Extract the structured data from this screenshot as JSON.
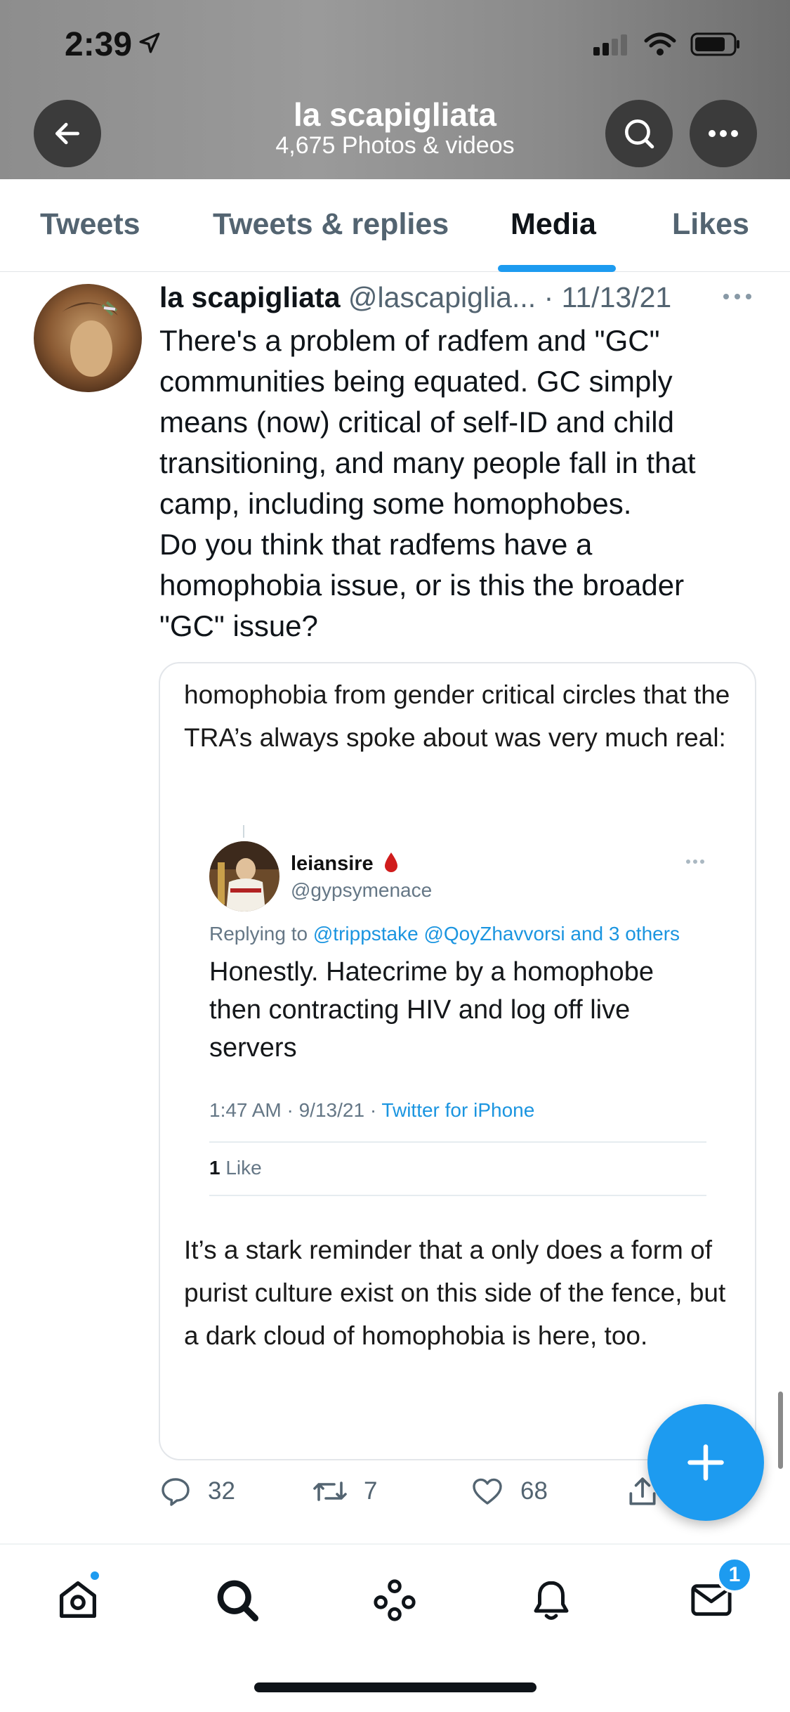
{
  "status_bar": {
    "time": "2:39"
  },
  "header": {
    "title": "la scapigliata",
    "subtitle": "4,675 Photos & videos"
  },
  "tabs": [
    {
      "label": "Tweets",
      "active": false
    },
    {
      "label": "Tweets & replies",
      "active": false
    },
    {
      "label": "Media",
      "active": true
    },
    {
      "label": "Likes",
      "active": false
    }
  ],
  "tweet": {
    "author_name": "la scapigliata",
    "author_handle": "@lascapiglia...",
    "date": "· 11/13/21",
    "text": "There's a problem of radfem and \"GC\" communities being equated. GC simply means (now) critical of self-ID and child transitioning, and many people fall in that camp, including some homophobes.\nDo you think that radfems have a homophobia issue, or is this the broader \"GC\" issue?",
    "quote": {
      "text_top": "homophobia from gender critical circles that the TRA’s always spoke about was very much real:",
      "embedded": {
        "name": "leiansire",
        "handle": "@gypsymenace",
        "replying_prefix": "Replying to ",
        "replying_to": "@trippstake @QoyZhavvorsi and 3 others",
        "text": "Honestly. Hatecrime by a homophobe then contracting HIV and log off live servers",
        "time": "1:47 AM · 9/13/21 · ",
        "source": "Twitter for iPhone",
        "like_count": "1",
        "like_label": " Like"
      },
      "text_bottom": "It’s a stark reminder that a only does a form of purist culture exist on this side of the fence, but a dark cloud of homophobia is here, too."
    },
    "actions": {
      "replies": "32",
      "retweets": "7",
      "likes": "68"
    }
  },
  "bottom_nav": {
    "messages_badge": "1"
  },
  "colors": {
    "accent": "#1d9bf0",
    "text": "#0f1419",
    "secondary": "#536471"
  }
}
